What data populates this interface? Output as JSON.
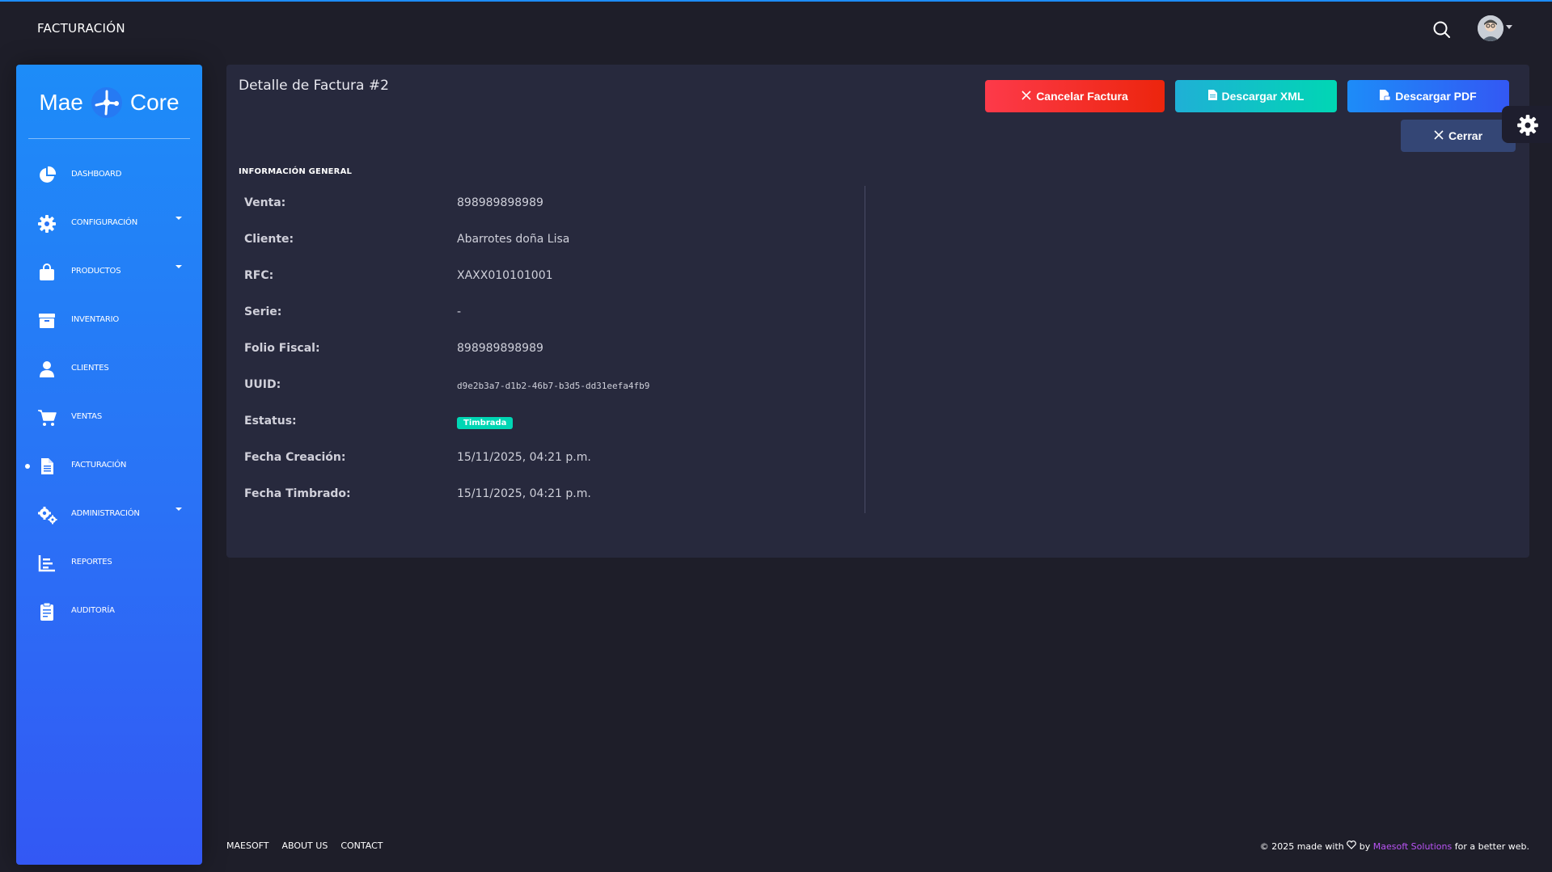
{
  "navbar": {
    "title": "FACTURACIÓN"
  },
  "sidebar": {
    "logo_left": "Mae",
    "logo_right": "Core",
    "items": [
      {
        "label": "DASHBOARD",
        "icon": "pie-chart-icon",
        "caret": false
      },
      {
        "label": "CONFIGURACIÓN",
        "icon": "gear-icon",
        "caret": true
      },
      {
        "label": "PRODUCTOS",
        "icon": "shopping-bag-icon",
        "caret": true
      },
      {
        "label": "INVENTARIO",
        "icon": "archive-box-icon",
        "caret": false
      },
      {
        "label": "CLIENTES",
        "icon": "user-icon",
        "caret": false
      },
      {
        "label": "VENTAS",
        "icon": "shopping-cart-icon",
        "caret": false
      },
      {
        "label": "FACTURACIÓN",
        "icon": "document-icon",
        "caret": false,
        "active": true
      },
      {
        "label": "ADMINISTRACIÓN",
        "icon": "gears-icon",
        "caret": true
      },
      {
        "label": "REPORTES",
        "icon": "bar-chart-icon",
        "caret": false
      },
      {
        "label": "AUDITORÍA",
        "icon": "clipboard-icon",
        "caret": false
      }
    ]
  },
  "card": {
    "title": "Detalle de Factura #2",
    "buttons": {
      "cancel": "Cancelar Factura",
      "xml": "Descargar XML",
      "pdf": "Descargar PDF",
      "close": "Cerrar"
    },
    "section_title": "INFORMACIÓN GENERAL",
    "fields": [
      {
        "label": "Venta:",
        "value": "898989898989"
      },
      {
        "label": "Cliente:",
        "value": "Abarrotes doña Lisa"
      },
      {
        "label": "RFC:",
        "value": "XAXX010101001"
      },
      {
        "label": "Serie:",
        "value": "-"
      },
      {
        "label": "Folio Fiscal:",
        "value": "898989898989"
      },
      {
        "label": "UUID:",
        "value": "d9e2b3a7-d1b2-46b7-b3d5-dd31eefa4fb9"
      },
      {
        "label": "Estatus:",
        "value": "Timbrada"
      },
      {
        "label": "Fecha Creación:",
        "value": "15/11/2025, 04:21 p.m."
      },
      {
        "label": "Fecha Timbrado:",
        "value": "15/11/2025, 04:21 p.m."
      }
    ]
  },
  "footer": {
    "links": [
      "MAESOFT",
      "ABOUT US",
      "CONTACT"
    ],
    "copy_prefix": "© 2025 made with",
    "copy_by": "by",
    "copy_brand": "Maesoft Solutions",
    "copy_suffix": "for a better web."
  },
  "colors": {
    "sidebar_gradient_start": "#1d8cf8",
    "sidebar_gradient_end": "#3358f4",
    "card_bg": "#27293d",
    "page_bg": "#1e1e29",
    "danger": "#fd3a4a",
    "info": "#1fb0d6",
    "success": "#00d6b4",
    "primary": "#1d8cf8",
    "brand_link": "#ba54f5"
  }
}
